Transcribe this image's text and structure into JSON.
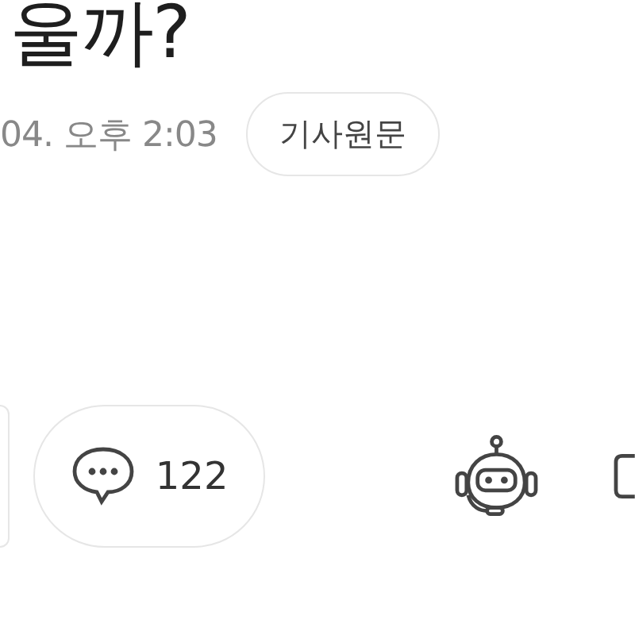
{
  "headline": "울까?",
  "meta": {
    "datetime": "04. 오후 2:03",
    "source_button": "기사원문"
  },
  "actions": {
    "comment_count": "122"
  }
}
